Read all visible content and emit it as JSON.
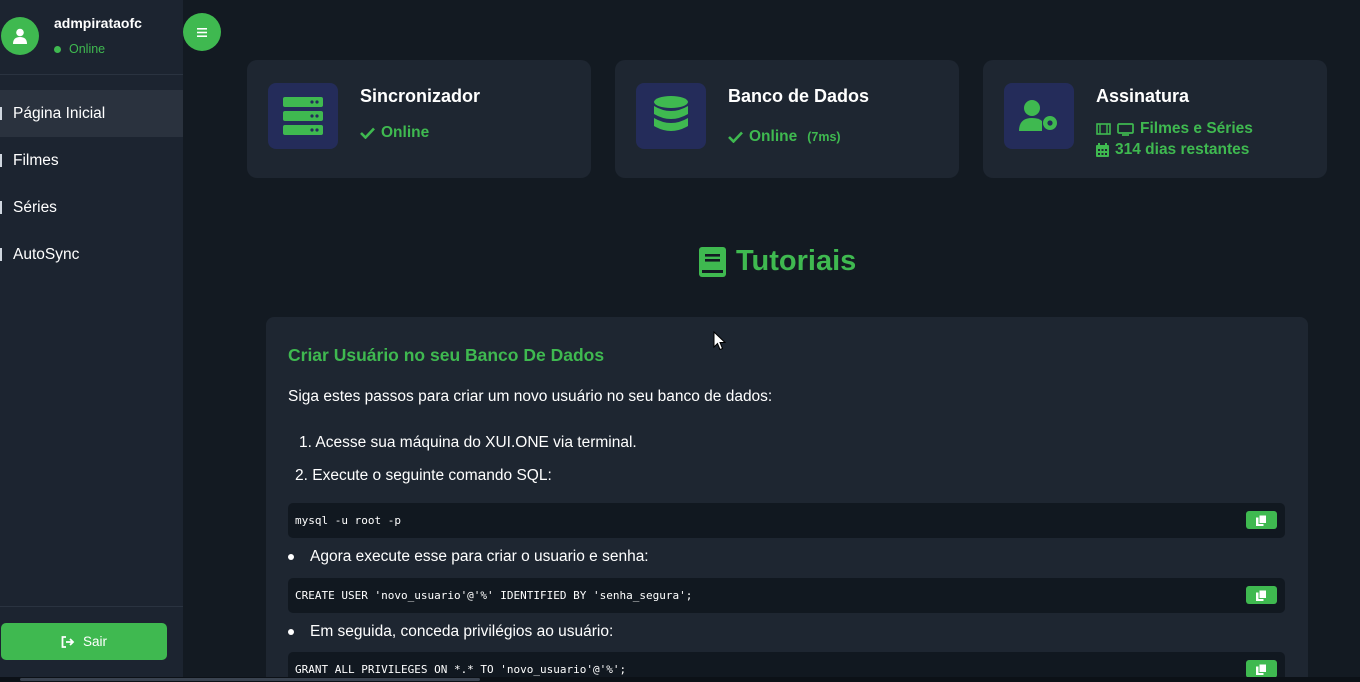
{
  "user": {
    "name": "admpirataofc",
    "status": "Online"
  },
  "nav": {
    "items": [
      {
        "label": "Página Inicial",
        "active": true
      },
      {
        "label": "Filmes",
        "active": false
      },
      {
        "label": "Séries",
        "active": false
      },
      {
        "label": "AutoSync",
        "active": false
      }
    ]
  },
  "logout_label": "Sair",
  "cards": {
    "sync": {
      "title": "Sincronizador",
      "status": "Online",
      "icon": "server-icon"
    },
    "db": {
      "title": "Banco de Dados",
      "status": "Online",
      "latency": "(7ms)",
      "icon": "database-icon"
    },
    "sub": {
      "title": "Assinatura",
      "plan": "Filmes e Séries",
      "remaining": "314 dias restantes",
      "icon": "user-cog-icon"
    }
  },
  "tutorials": {
    "heading": "Tutoriais",
    "title": "Criar Usuário no seu Banco De Dados",
    "intro": "Siga estes passos para criar um novo usuário no seu banco de dados:",
    "step1": "1. Acesse sua máquina do XUI.ONE via terminal.",
    "step2": "2. Execute o seguinte comando SQL:",
    "code1": "mysql -u root -p",
    "bullet1": "Agora execute esse para criar o usuario e senha:",
    "code2": "CREATE USER 'novo_usuario'@'%' IDENTIFIED BY 'senha_segura';",
    "bullet2": "Em seguida, conceda privilégios ao usuário:",
    "code3": "GRANT ALL PRIVILEGES ON *.* TO 'novo_usuario'@'%';"
  },
  "colors": {
    "accent": "#3fb950",
    "background": "#131a22",
    "sidebar": "#1c2430",
    "card": "#1e2631",
    "icon_bg": "#242c5a"
  }
}
